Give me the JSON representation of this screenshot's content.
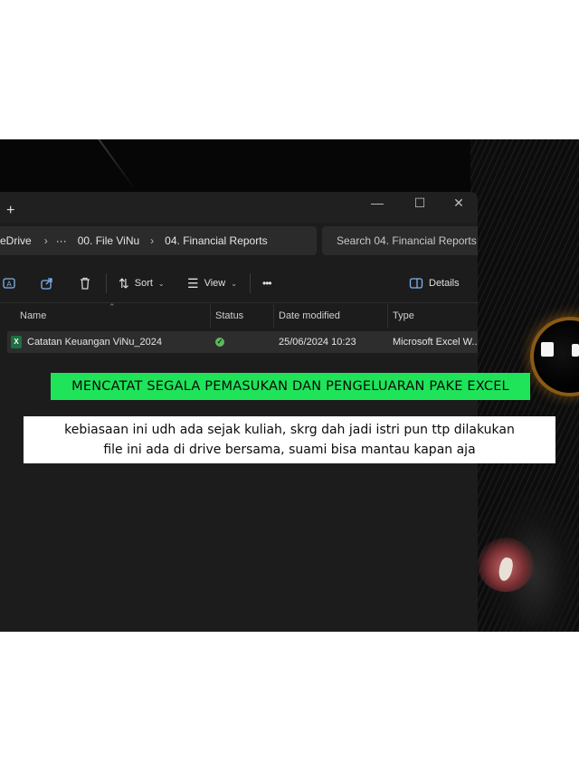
{
  "explorer": {
    "new_tab_label": "+",
    "window_controls": {
      "minimize": "—",
      "maximize": "☐",
      "close": "✕"
    },
    "breadcrumbs": [
      "eDrive",
      "···",
      "00. File ViNu",
      "04. Financial Reports"
    ],
    "breadcrumb_separator": "›",
    "search_placeholder": "Search 04. Financial Reports",
    "toolbar": {
      "icons": [
        "rename-icon",
        "share-icon",
        "delete-icon"
      ],
      "sort_label": "Sort",
      "view_label": "View",
      "more_label": "•••",
      "details_label": "Details"
    },
    "columns": {
      "name": "Name",
      "status": "Status",
      "date_modified": "Date modified",
      "type": "Type"
    },
    "files": [
      {
        "name": "Catatan Keuangan ViNu_2024",
        "status_icon": "synced-check-icon",
        "date_modified": "25/06/2024 10:23",
        "type": "Microsoft Excel W..."
      }
    ]
  },
  "overlay": {
    "headline": "MENCATAT SEGALA PEMASUKAN DAN PENGELUARAN PAKE EXCEL",
    "caption_lines": [
      "kebiasaan ini udh ada sejak kuliah, skrg dah jadi istri pun ttp dilakukan",
      "file ini ada di drive bersama, suami bisa mantau kapan aja"
    ]
  },
  "colors": {
    "window_bg": "#1c1c1c",
    "headline_bg": "#1fe45a",
    "caption_bg": "#ffffff",
    "excel_green": "#1d6f42",
    "status_green": "#5cb85c"
  }
}
